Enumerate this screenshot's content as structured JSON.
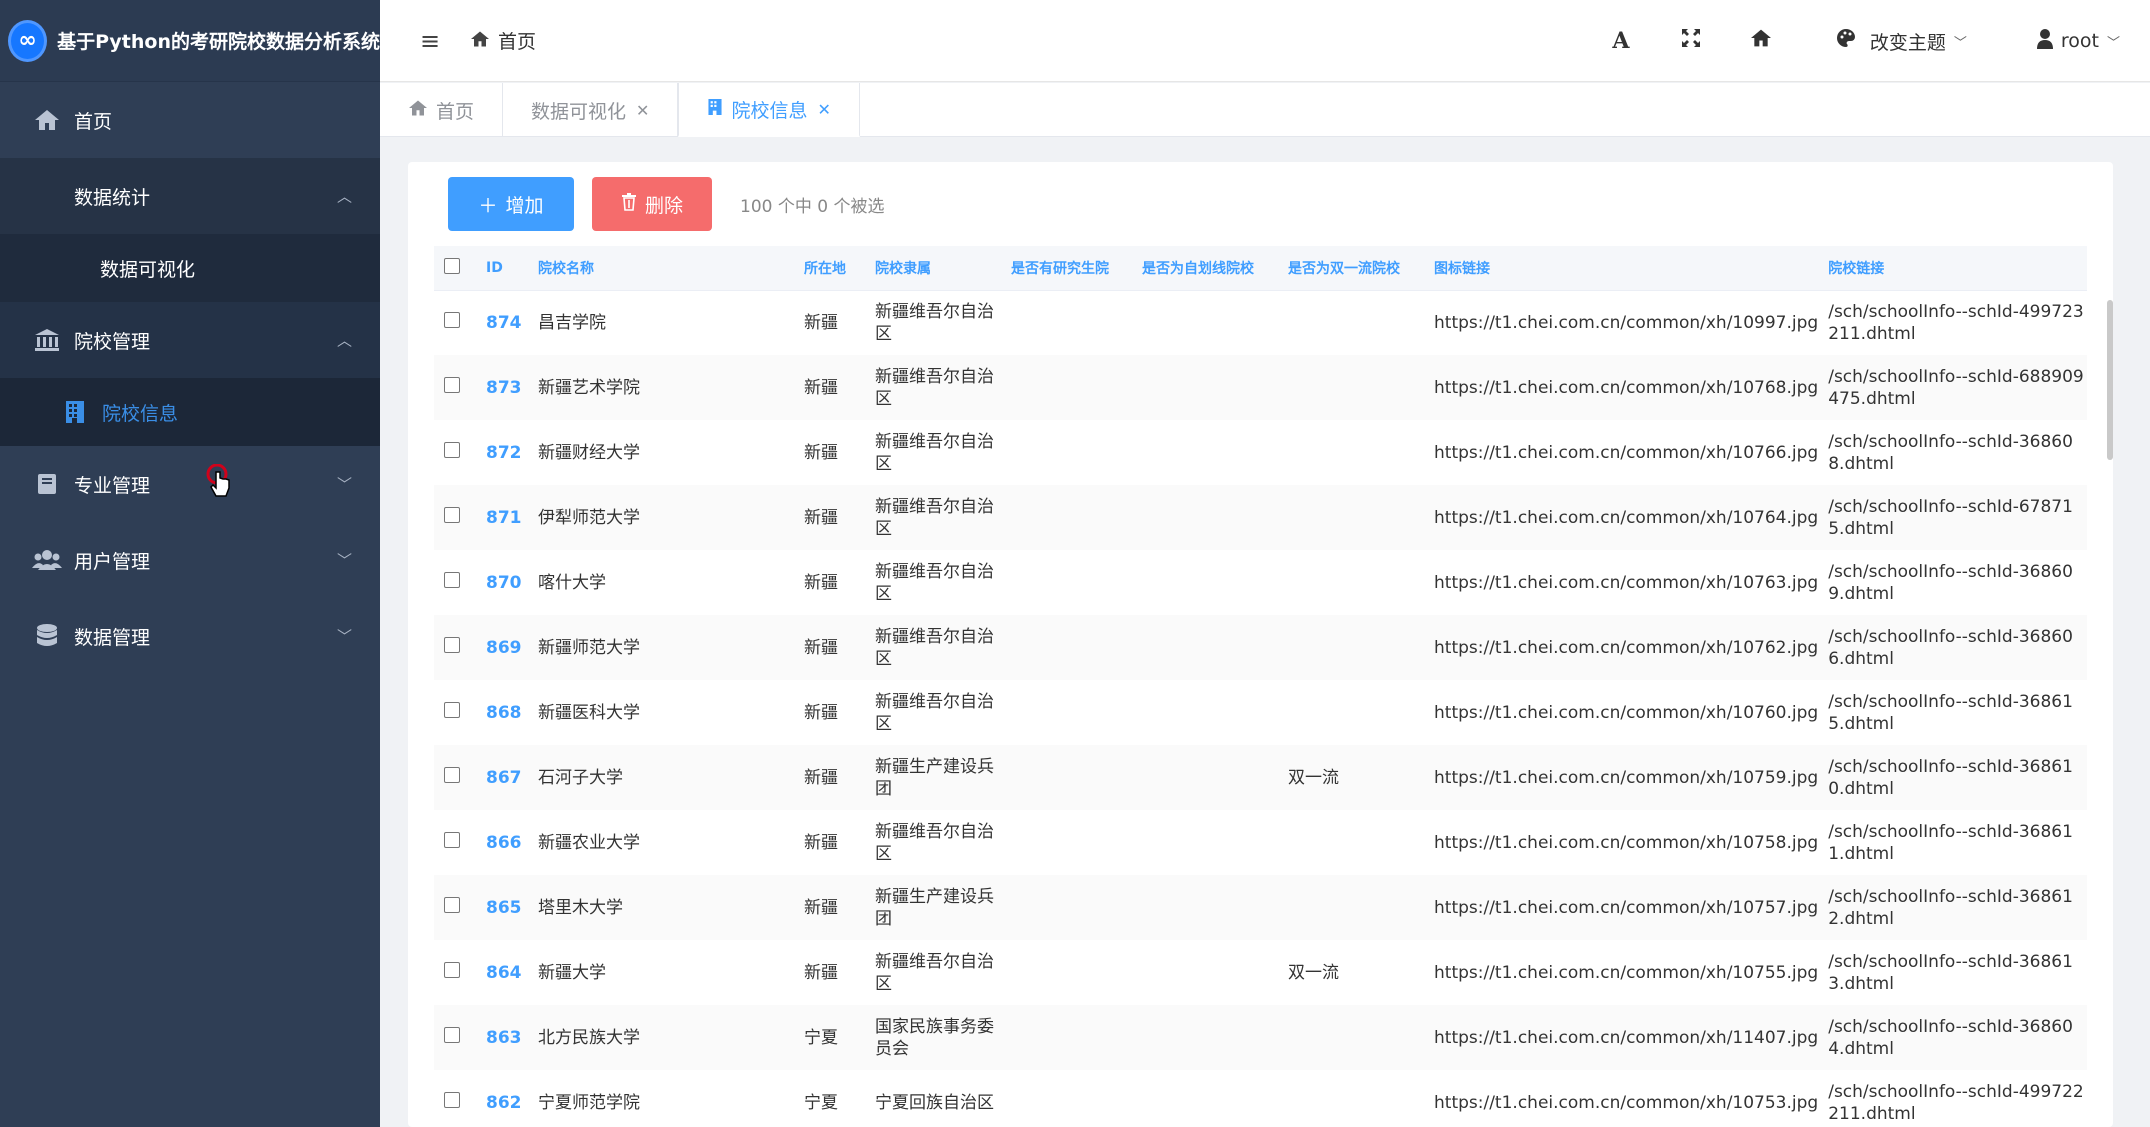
{
  "app": {
    "title": "基于Python的考研院校数据分析系统",
    "logo_text": "∞"
  },
  "sidebar": {
    "items": [
      {
        "label": "首页",
        "icon": "home-icon"
      },
      {
        "label": "数据统计"
      },
      {
        "label": "数据可视化"
      },
      {
        "label": "院校管理",
        "icon": "bank-icon"
      },
      {
        "label": "院校信息",
        "icon": "building-icon"
      },
      {
        "label": "专业管理",
        "icon": "book-icon"
      },
      {
        "label": "用户管理",
        "icon": "users-icon"
      },
      {
        "label": "数据管理",
        "icon": "database-icon"
      }
    ]
  },
  "header": {
    "breadcrumb": "首页",
    "theme_label": "改变主题",
    "user_label": "root",
    "font_btn": "A"
  },
  "tabs": [
    {
      "label": "首页"
    },
    {
      "label": "数据可视化"
    },
    {
      "label": "院校信息"
    }
  ],
  "toolbar": {
    "add_label": "增加",
    "delete_label": "删除",
    "selection_info": "100 个中 0 个被选"
  },
  "table": {
    "columns": [
      "ID",
      "院校名称",
      "所在地",
      "院校隶属",
      "是否有研究生院",
      "是否为自划线院校",
      "是否为双一流院校",
      "图标链接",
      "院校链接"
    ],
    "rows": [
      {
        "id": "874",
        "name": "昌吉学院",
        "loc": "新疆",
        "belong": "新疆维吾尔自治区",
        "grad": "",
        "self": "",
        "dfc": "",
        "icon": "https://t1.chei.com.cn/common/xh/10997.jpg",
        "link": "/sch/schoolInfo--schId-499723211.dhtml"
      },
      {
        "id": "873",
        "name": "新疆艺术学院",
        "loc": "新疆",
        "belong": "新疆维吾尔自治区",
        "grad": "",
        "self": "",
        "dfc": "",
        "icon": "https://t1.chei.com.cn/common/xh/10768.jpg",
        "link": "/sch/schoolInfo--schId-688909475.dhtml"
      },
      {
        "id": "872",
        "name": "新疆财经大学",
        "loc": "新疆",
        "belong": "新疆维吾尔自治区",
        "grad": "",
        "self": "",
        "dfc": "",
        "icon": "https://t1.chei.com.cn/common/xh/10766.jpg",
        "link": "/sch/schoolInfo--schId-368608.dhtml"
      },
      {
        "id": "871",
        "name": "伊犁师范大学",
        "loc": "新疆",
        "belong": "新疆维吾尔自治区",
        "grad": "",
        "self": "",
        "dfc": "",
        "icon": "https://t1.chei.com.cn/common/xh/10764.jpg",
        "link": "/sch/schoolInfo--schId-678715.dhtml"
      },
      {
        "id": "870",
        "name": "喀什大学",
        "loc": "新疆",
        "belong": "新疆维吾尔自治区",
        "grad": "",
        "self": "",
        "dfc": "",
        "icon": "https://t1.chei.com.cn/common/xh/10763.jpg",
        "link": "/sch/schoolInfo--schId-368609.dhtml"
      },
      {
        "id": "869",
        "name": "新疆师范大学",
        "loc": "新疆",
        "belong": "新疆维吾尔自治区",
        "grad": "",
        "self": "",
        "dfc": "",
        "icon": "https://t1.chei.com.cn/common/xh/10762.jpg",
        "link": "/sch/schoolInfo--schId-368606.dhtml"
      },
      {
        "id": "868",
        "name": "新疆医科大学",
        "loc": "新疆",
        "belong": "新疆维吾尔自治区",
        "grad": "",
        "self": "",
        "dfc": "",
        "icon": "https://t1.chei.com.cn/common/xh/10760.jpg",
        "link": "/sch/schoolInfo--schId-368615.dhtml"
      },
      {
        "id": "867",
        "name": "石河子大学",
        "loc": "新疆",
        "belong": "新疆生产建设兵团",
        "grad": "",
        "self": "",
        "dfc": "双一流",
        "icon": "https://t1.chei.com.cn/common/xh/10759.jpg",
        "link": "/sch/schoolInfo--schId-368610.dhtml"
      },
      {
        "id": "866",
        "name": "新疆农业大学",
        "loc": "新疆",
        "belong": "新疆维吾尔自治区",
        "grad": "",
        "self": "",
        "dfc": "",
        "icon": "https://t1.chei.com.cn/common/xh/10758.jpg",
        "link": "/sch/schoolInfo--schId-368611.dhtml"
      },
      {
        "id": "865",
        "name": "塔里木大学",
        "loc": "新疆",
        "belong": "新疆生产建设兵团",
        "grad": "",
        "self": "",
        "dfc": "",
        "icon": "https://t1.chei.com.cn/common/xh/10757.jpg",
        "link": "/sch/schoolInfo--schId-368612.dhtml"
      },
      {
        "id": "864",
        "name": "新疆大学",
        "loc": "新疆",
        "belong": "新疆维吾尔自治区",
        "grad": "",
        "self": "",
        "dfc": "双一流",
        "icon": "https://t1.chei.com.cn/common/xh/10755.jpg",
        "link": "/sch/schoolInfo--schId-368613.dhtml"
      },
      {
        "id": "863",
        "name": "北方民族大学",
        "loc": "宁夏",
        "belong": "国家民族事务委员会",
        "grad": "",
        "self": "",
        "dfc": "",
        "icon": "https://t1.chei.com.cn/common/xh/11407.jpg",
        "link": "/sch/schoolInfo--schId-368604.dhtml"
      },
      {
        "id": "862",
        "name": "宁夏师范学院",
        "loc": "宁夏",
        "belong": "宁夏回族自治区",
        "grad": "",
        "self": "",
        "dfc": "",
        "icon": "https://t1.chei.com.cn/common/xh/10753.jpg",
        "link": "/sch/schoolInfo--schId-499722211.dhtml"
      }
    ]
  }
}
